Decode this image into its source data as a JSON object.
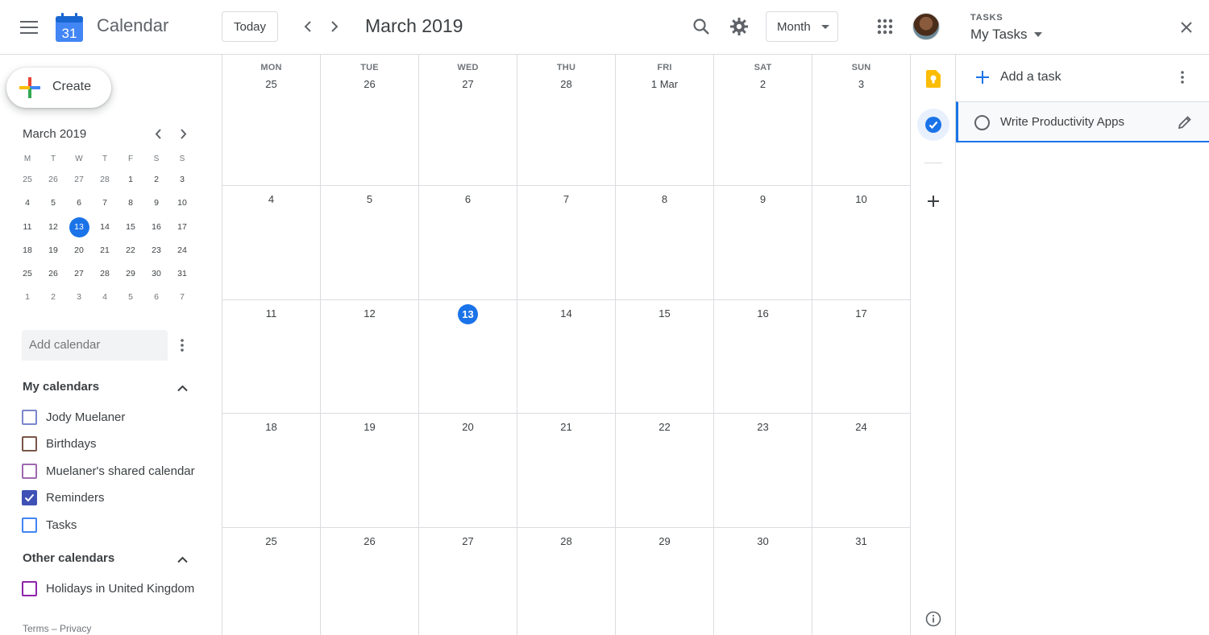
{
  "header": {
    "app_title": "Calendar",
    "logo_day": "31",
    "today_label": "Today",
    "period_title": "March 2019",
    "view_mode": "Month"
  },
  "sidebar": {
    "create_label": "Create",
    "mini_calendar": {
      "title": "March 2019",
      "weekdays": [
        "M",
        "T",
        "W",
        "T",
        "F",
        "S",
        "S"
      ],
      "weeks": [
        [
          "25",
          "26",
          "27",
          "28",
          "1",
          "2",
          "3"
        ],
        [
          "4",
          "5",
          "6",
          "7",
          "8",
          "9",
          "10"
        ],
        [
          "11",
          "12",
          "13",
          "14",
          "15",
          "16",
          "17"
        ],
        [
          "18",
          "19",
          "20",
          "21",
          "22",
          "23",
          "24"
        ],
        [
          "25",
          "26",
          "27",
          "28",
          "29",
          "30",
          "31"
        ],
        [
          "1",
          "2",
          "3",
          "4",
          "5",
          "6",
          "7"
        ]
      ]
    },
    "add_calendar_placeholder": "Add calendar",
    "my_calendars_title": "My calendars",
    "my_calendars": [
      {
        "name": "Jody Muelaner",
        "color": "#7986cb",
        "checked": false
      },
      {
        "name": "Birthdays",
        "color": "#795548",
        "checked": false
      },
      {
        "name": "Muelaner's shared calendar",
        "color": "#9e69af",
        "checked": false
      },
      {
        "name": "Reminders",
        "color": "#3f51b5",
        "checked": true
      },
      {
        "name": "Tasks",
        "color": "#4285f4",
        "checked": false
      }
    ],
    "other_calendars_title": "Other calendars",
    "other_calendars": [
      {
        "name": "Holidays in United Kingdom",
        "color": "#8e24aa",
        "checked": false
      }
    ],
    "footer": {
      "terms": "Terms",
      "separator": "–",
      "privacy": "Privacy"
    }
  },
  "month_grid": {
    "weekday_headers": [
      "MON",
      "TUE",
      "WED",
      "THU",
      "FRI",
      "SAT",
      "SUN"
    ],
    "weeks": [
      [
        "25",
        "26",
        "27",
        "28",
        "1 Mar",
        "2",
        "3"
      ],
      [
        "4",
        "5",
        "6",
        "7",
        "8",
        "9",
        "10"
      ],
      [
        "11",
        "12",
        "13",
        "14",
        "15",
        "16",
        "17"
      ],
      [
        "18",
        "19",
        "20",
        "21",
        "22",
        "23",
        "24"
      ],
      [
        "25",
        "26",
        "27",
        "28",
        "29",
        "30",
        "31"
      ]
    ],
    "today": "13"
  },
  "tasks_panel": {
    "label": "TASKS",
    "list_name": "My Tasks",
    "add_task_label": "Add a task",
    "tasks": [
      {
        "title": "Write Productivity Apps",
        "completed": false
      }
    ]
  },
  "colors": {
    "accent": "#1a73e8",
    "border": "#dadce0",
    "text": "#3c4043",
    "muted": "#70757a"
  }
}
